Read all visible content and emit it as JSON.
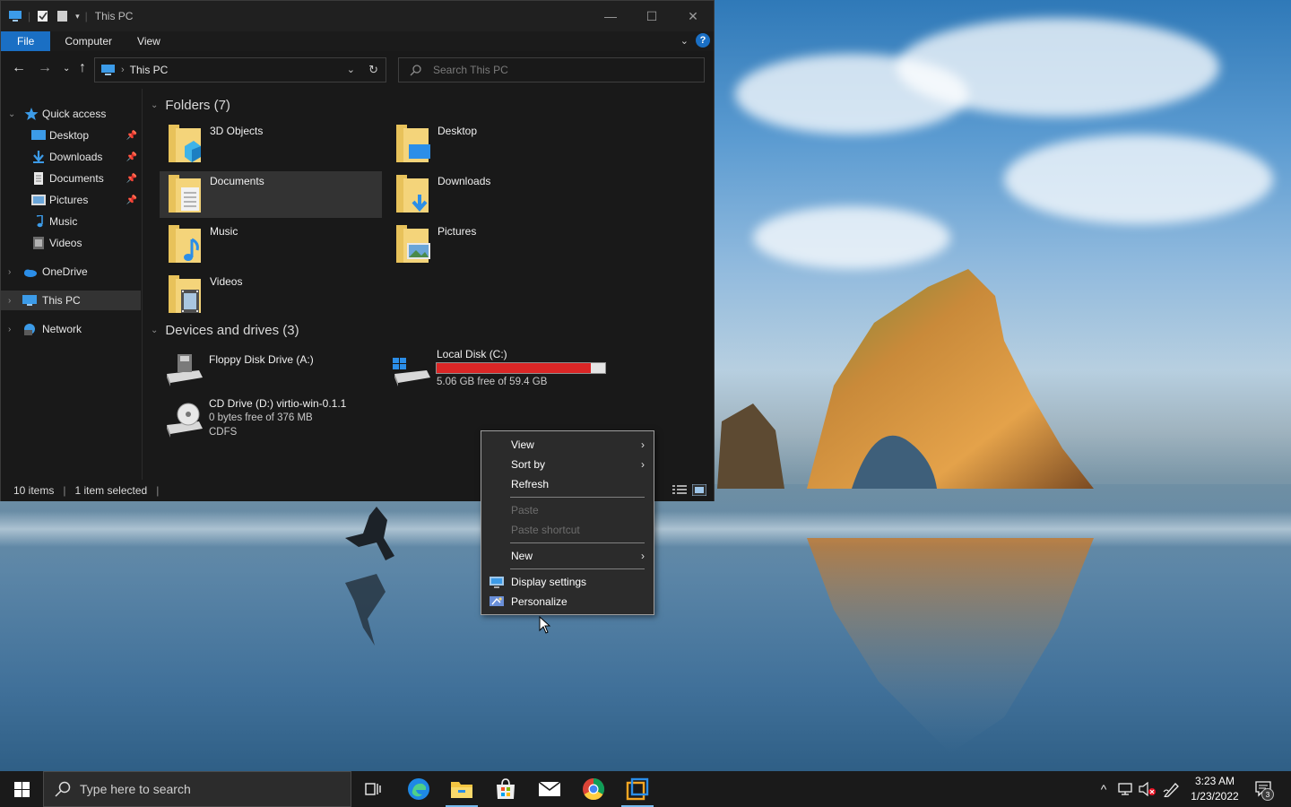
{
  "window": {
    "title": "This PC",
    "controls": {
      "minimize": "—",
      "maximize": "☐",
      "close": "✕"
    }
  },
  "ribbon": {
    "tabs": [
      "File",
      "Computer",
      "View"
    ]
  },
  "address": {
    "path": "This PC",
    "search_placeholder": "Search This PC"
  },
  "sidebar": {
    "quick_access": "Quick access",
    "items": [
      {
        "label": "Desktop",
        "icon": "desktop-icon",
        "pinned": true
      },
      {
        "label": "Downloads",
        "icon": "downloads-icon",
        "pinned": true
      },
      {
        "label": "Documents",
        "icon": "documents-icon",
        "pinned": true
      },
      {
        "label": "Pictures",
        "icon": "pictures-icon",
        "pinned": true
      },
      {
        "label": "Music",
        "icon": "music-icon",
        "pinned": false
      },
      {
        "label": "Videos",
        "icon": "videos-icon",
        "pinned": false
      }
    ],
    "onedrive": "OneDrive",
    "this_pc": "This PC",
    "network": "Network"
  },
  "content": {
    "folders_header": "Folders (7)",
    "folders": [
      {
        "label": "3D Objects",
        "icon": "3d-objects-folder-icon"
      },
      {
        "label": "Desktop",
        "icon": "desktop-folder-icon"
      },
      {
        "label": "Documents",
        "icon": "documents-folder-icon",
        "selected": true
      },
      {
        "label": "Downloads",
        "icon": "downloads-folder-icon"
      },
      {
        "label": "Music",
        "icon": "music-folder-icon"
      },
      {
        "label": "Pictures",
        "icon": "pictures-folder-icon"
      },
      {
        "label": "Videos",
        "icon": "videos-folder-icon"
      }
    ],
    "drives_header": "Devices and drives (3)",
    "drives": {
      "floppy": {
        "label": "Floppy Disk Drive (A:)"
      },
      "local": {
        "label": "Local Disk (C:)",
        "free": "5.06 GB free of 59.4 GB",
        "used_fraction": 0.915
      },
      "cd": {
        "label": "CD Drive (D:) virtio-win-0.1.1",
        "free": "0 bytes free of 376 MB",
        "fs": "CDFS"
      }
    }
  },
  "status": {
    "items": "10 items",
    "selected": "1 item selected"
  },
  "context_menu": {
    "view": "View",
    "sort_by": "Sort by",
    "refresh": "Refresh",
    "paste": "Paste",
    "paste_shortcut": "Paste shortcut",
    "new": "New",
    "display_settings": "Display settings",
    "personalize": "Personalize"
  },
  "taskbar": {
    "search_placeholder": "Type here to search",
    "time": "3:23 AM",
    "date": "1/23/2022",
    "notification_count": "3"
  },
  "colors": {
    "accent": "#1a6fc4",
    "usage_bar": "#da2626",
    "taskbar_indicator": "#76b9ed"
  }
}
